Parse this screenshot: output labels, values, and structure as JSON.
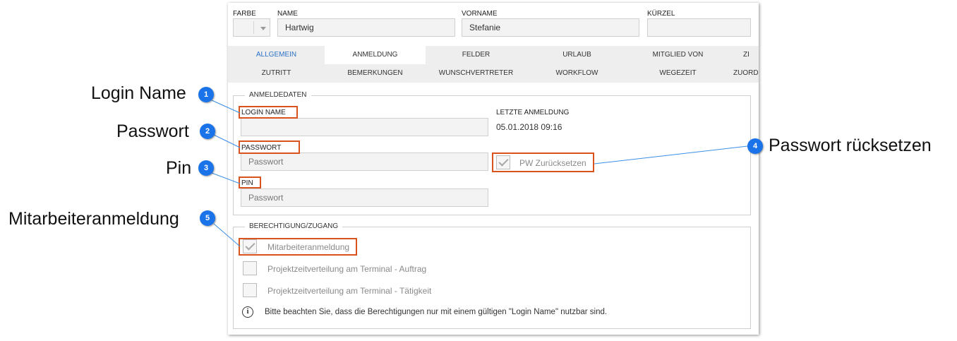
{
  "header": {
    "farbe_label": "FARBE",
    "name_label": "NAME",
    "name_value": "Hartwig",
    "vorname_label": "VORNAME",
    "vorname_value": "Stefanie",
    "kuerzel_label": "KÜRZEL",
    "kuerzel_value": ""
  },
  "tabs_row1": [
    "ALLGEMEIN",
    "ANMELDUNG",
    "FELDER",
    "URLAUB",
    "MITGLIED VON",
    "ZI"
  ],
  "tabs_row2": [
    "ZUTRITT",
    "BEMERKUNGEN",
    "WUNSCHVERTRETER",
    "WORKFLOW",
    "WEGEZEIT",
    "ZUORD"
  ],
  "anmeldedaten": {
    "legend": "ANMELDEDATEN",
    "login_label": "LOGIN NAME",
    "login_value": "",
    "passwort_label": "PASSWORT",
    "passwort_placeholder": "Passwort",
    "pin_label": "PIN",
    "pin_placeholder": "Passwort",
    "letzte_label": "LETZTE ANMELDUNG",
    "letzte_value": "05.01.2018 09:16",
    "reset_label": "PW Zurücksetzen",
    "reset_checked": true
  },
  "berechtigung": {
    "legend": "BERECHTIGUNG/ZUGANG",
    "items": [
      {
        "label": "Mitarbeiteranmeldung",
        "checked": true
      },
      {
        "label": "Projektzeitverteilung am Terminal - Auftrag",
        "checked": false
      },
      {
        "label": "Projektzeitverteilung am Terminal - Tätigkeit",
        "checked": false
      }
    ],
    "info_text": "Bitte beachten Sie, dass die Berechtigungen nur mit einem gültigen \"Login Name\" nutzbar sind."
  },
  "callouts": [
    {
      "number": "1",
      "text": "Login Name"
    },
    {
      "number": "2",
      "text": "Passwort"
    },
    {
      "number": "3",
      "text": "Pin"
    },
    {
      "number": "4",
      "text": "Passwort rücksetzen"
    },
    {
      "number": "5",
      "text": "Mitarbeiteranmeldung"
    }
  ],
  "colors": {
    "accent": "#1a73e8",
    "highlight": "#d9531e",
    "active_tab_text": "#2a72c9"
  }
}
